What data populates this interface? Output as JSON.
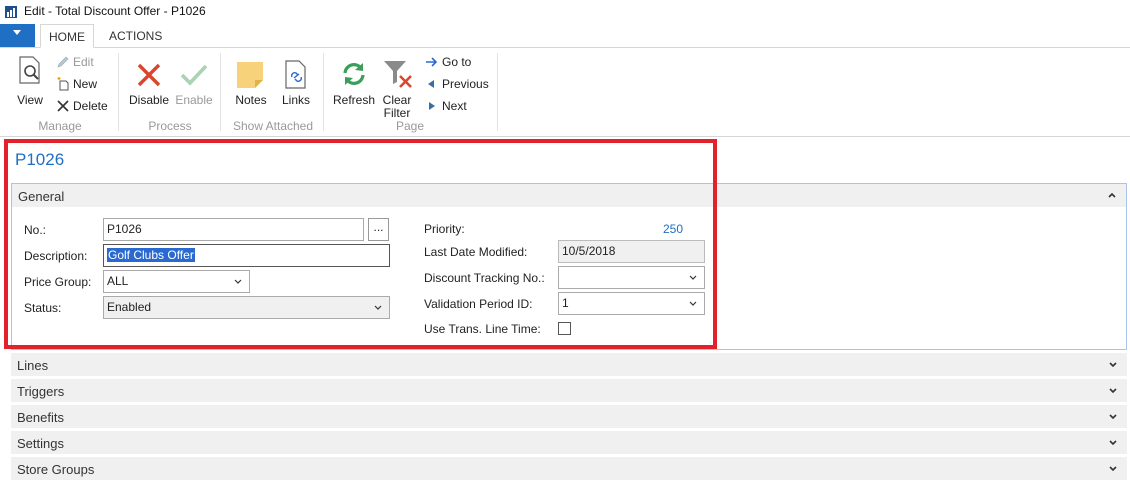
{
  "window": {
    "title": "Edit - Total Discount Offer - P1026"
  },
  "ribbon_tabs": [
    {
      "label": "HOME",
      "active": true
    },
    {
      "label": "ACTIONS",
      "active": false
    }
  ],
  "ribbon": {
    "groups": {
      "manage": {
        "label": "Manage",
        "view": "View",
        "edit": "Edit",
        "new": "New",
        "delete": "Delete"
      },
      "process": {
        "label": "Process",
        "disable": "Disable",
        "enable": "Enable"
      },
      "show_attached": {
        "label": "Show Attached",
        "notes": "Notes",
        "links": "Links"
      },
      "page": {
        "label": "Page",
        "refresh": "Refresh",
        "clear_filter_1": "Clear",
        "clear_filter_2": "Filter",
        "goto": "Go to",
        "previous": "Previous",
        "next": "Next"
      }
    }
  },
  "page_title": "P1026",
  "general": {
    "header": "General",
    "no_label": "No.:",
    "no_value": "P1026",
    "ellipsis": "...",
    "description_label": "Description:",
    "description_value": "Golf Clubs Offer",
    "price_group_label": "Price Group:",
    "price_group_value": "ALL",
    "status_label": "Status:",
    "status_value": "Enabled",
    "priority_label": "Priority:",
    "priority_value": "250",
    "last_modified_label": "Last Date Modified:",
    "last_modified_value": "10/5/2018",
    "discount_tracking_label": "Discount Tracking No.:",
    "discount_tracking_value": "",
    "validation_period_label": "Validation Period ID:",
    "validation_period_value": "1",
    "use_trans_label": "Use Trans. Line Time:",
    "use_trans_checked": false
  },
  "fasttabs": [
    "Lines",
    "Triggers",
    "Benefits",
    "Settings",
    "Store Groups"
  ],
  "colors": {
    "accent": "#1f6fc5",
    "highlight": "#e3212d"
  }
}
